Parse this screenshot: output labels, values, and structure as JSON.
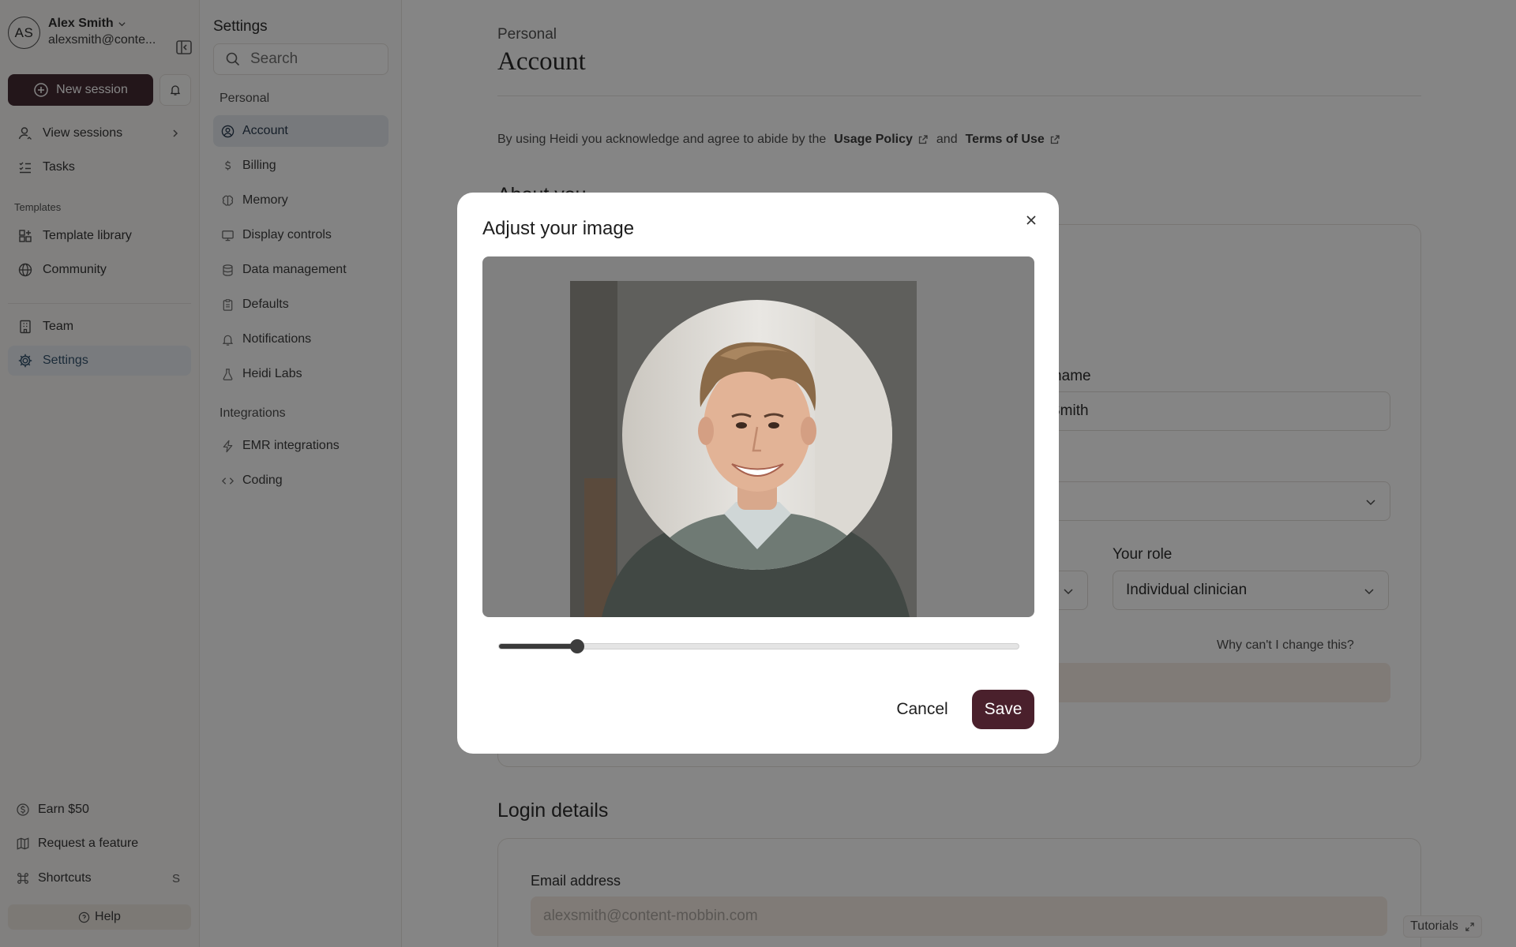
{
  "user": {
    "initials": "AS",
    "name": "Alex Smith",
    "email": "alexsmith@conte..."
  },
  "sidebar": {
    "new_session": "New session",
    "nav": [
      {
        "label": "View sessions",
        "icon": "user-icon"
      },
      {
        "label": "Tasks",
        "icon": "list-check-icon"
      }
    ],
    "templates_heading": "Templates",
    "templates": [
      {
        "label": "Template library",
        "icon": "grid-plus-icon"
      },
      {
        "label": "Community",
        "icon": "globe-icon"
      }
    ],
    "workspace": [
      {
        "label": "Team",
        "icon": "building-icon"
      },
      {
        "label": "Settings",
        "icon": "gear-icon",
        "active": true
      }
    ],
    "footer": [
      {
        "label": "Earn $50",
        "icon": "dollar-circle-icon"
      },
      {
        "label": "Request a feature",
        "icon": "map-icon"
      },
      {
        "label": "Shortcuts",
        "icon": "command-icon",
        "shortcut": "S"
      }
    ],
    "help": "Help"
  },
  "settings": {
    "title": "Settings",
    "search_placeholder": "Search",
    "personal_heading": "Personal",
    "personal": [
      {
        "label": "Account",
        "icon": "user-circle-icon",
        "active": true
      },
      {
        "label": "Billing",
        "icon": "dollar-icon"
      },
      {
        "label": "Memory",
        "icon": "brain-icon"
      },
      {
        "label": "Display controls",
        "icon": "monitor-icon"
      },
      {
        "label": "Data management",
        "icon": "database-icon"
      },
      {
        "label": "Defaults",
        "icon": "clipboard-icon"
      },
      {
        "label": "Notifications",
        "icon": "bell-icon"
      },
      {
        "label": "Heidi Labs",
        "icon": "flask-icon"
      }
    ],
    "integrations_heading": "Integrations",
    "integrations": [
      {
        "label": "EMR integrations",
        "icon": "lightning-icon"
      },
      {
        "label": "Coding",
        "icon": "code-icon"
      }
    ]
  },
  "main": {
    "breadcrumb": "Personal",
    "title": "Account",
    "policy_text": "By using Heidi you acknowledge and agree to abide by the",
    "usage_policy": "Usage Policy",
    "and": "and",
    "terms": "Terms of Use",
    "about_title": "About you",
    "last_name_label": "Last name",
    "last_name_partial_label": "st name",
    "last_name_value": "Smith",
    "last_name_partial_value": "Smith",
    "role_label": "Your role",
    "role_value": "Individual clinician",
    "why_link": "Why can't I change this?",
    "login_title": "Login details",
    "email_label": "Email address",
    "email_value": "alexsmith@content-mobbin.com",
    "tutorials": "Tutorials"
  },
  "modal": {
    "title": "Adjust your image",
    "zoom_level": 0.15,
    "cancel": "Cancel",
    "save": "Save"
  },
  "colors": {
    "primary": "#3a2129",
    "save_button": "#4a202c",
    "active_nav_bg": "#e6ebf0",
    "locked_field_bg": "#f4ebe3"
  }
}
